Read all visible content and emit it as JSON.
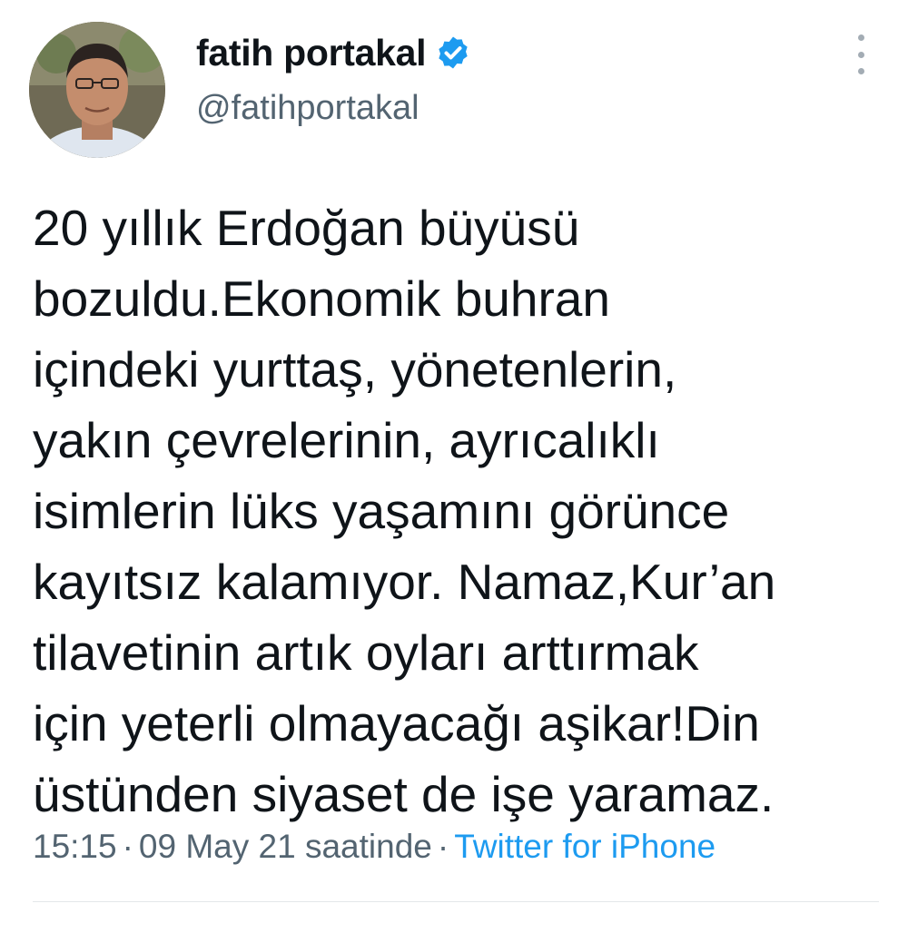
{
  "author": {
    "display_name": "fatih portakal",
    "handle": "@fatihportakal",
    "verified": true,
    "avatar_icon": "profile-photo"
  },
  "menu": {
    "icon": "more-vertical-icon"
  },
  "tweet": {
    "lines": [
      "20 yıllık Erdoğan büyüsü",
      "bozuldu.Ekonomik buhran",
      "içindeki yurttaş, yönetenlerin,",
      "yakın çevrelerinin, ayrıcalıklı",
      "isimlerin lüks yaşamını görünce",
      "kayıtsız kalamıyor. Namaz,Kur’an",
      "tilavetinin artık oyları arttırmak",
      "için yeterli olmayacağı aşikar!Din",
      "üstünden siyaset de işe yaramaz."
    ]
  },
  "meta": {
    "time": "15:15",
    "separator": "·",
    "date": "09 May 21 saatinde",
    "source": "Twitter for iPhone"
  },
  "colors": {
    "text": "#0f1419",
    "secondary": "#536471",
    "link": "#1d9bf0",
    "verified": "#1d9bf0",
    "divider": "#e3e7ea"
  }
}
